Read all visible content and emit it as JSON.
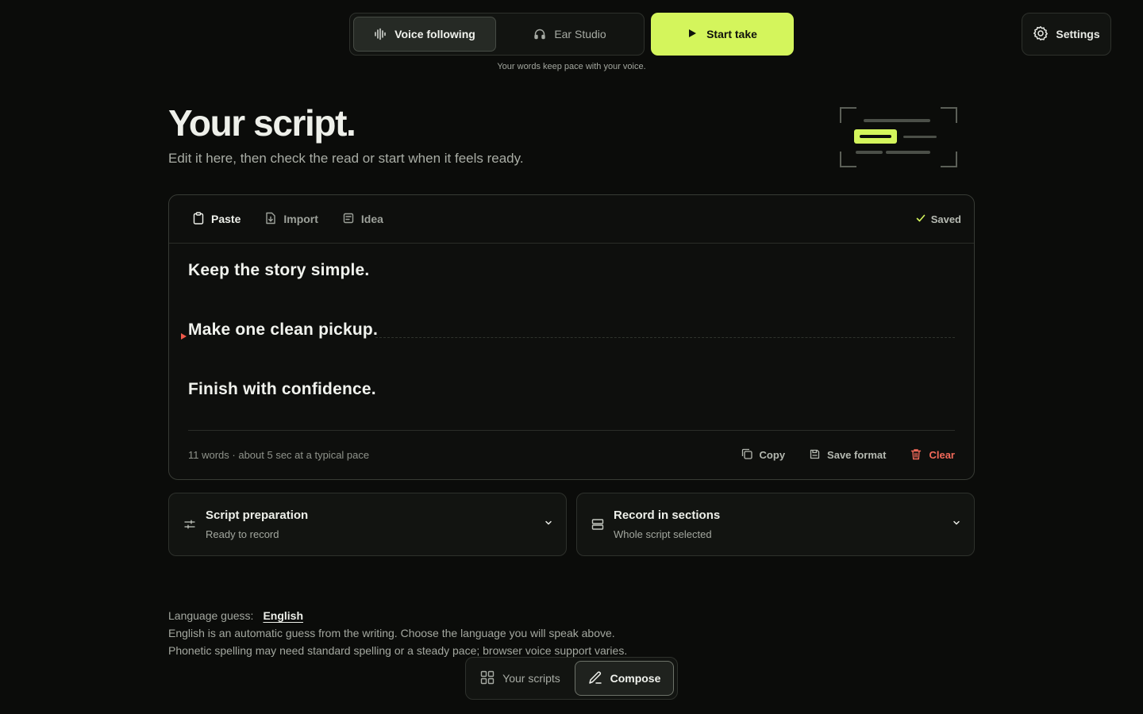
{
  "topbar": {
    "modes": [
      {
        "label": "Voice following",
        "icon": "waveform-icon",
        "active": true
      },
      {
        "label": "Ear Studio",
        "icon": "headphones-icon",
        "active": false
      }
    ],
    "start_label": "Start take",
    "settings_label": "Settings",
    "mode_hint": "Your words keep pace with your voice."
  },
  "hero": {
    "title": "Your script.",
    "subtitle": "Edit it here, then check the read or start when it feels ready."
  },
  "editor": {
    "tools": [
      {
        "label": "Paste",
        "icon": "clipboard-icon",
        "active": true
      },
      {
        "label": "Import",
        "icon": "file-import-icon",
        "active": false
      },
      {
        "label": "Idea",
        "icon": "note-icon",
        "active": false
      }
    ],
    "saved_label": "Saved",
    "lines": [
      "Keep the story simple.",
      "Make one clean pickup.",
      "Finish with confidence."
    ],
    "stats": "11 words · about 5 sec at a typical pace",
    "actions": {
      "copy": "Copy",
      "save_format": "Save format",
      "clear": "Clear"
    }
  },
  "panels": {
    "preparation": {
      "title": "Script preparation",
      "subtitle": "Ready to record",
      "icon": "sliders-icon"
    },
    "sections": {
      "title": "Record in sections",
      "subtitle": "Whole script selected",
      "icon": "rows-icon"
    }
  },
  "language": {
    "label": "Language guess:",
    "value": "English",
    "note": "English is an automatic guess from the writing. Choose the language you will speak above. Phonetic spelling may need standard spelling or a steady pace; browser voice support varies."
  },
  "bottom_nav": {
    "scripts_label": "Your scripts",
    "compose_label": "Compose"
  },
  "colors": {
    "accent": "#d4f55c",
    "background": "#0b0c0a",
    "danger": "#f26a5a"
  }
}
